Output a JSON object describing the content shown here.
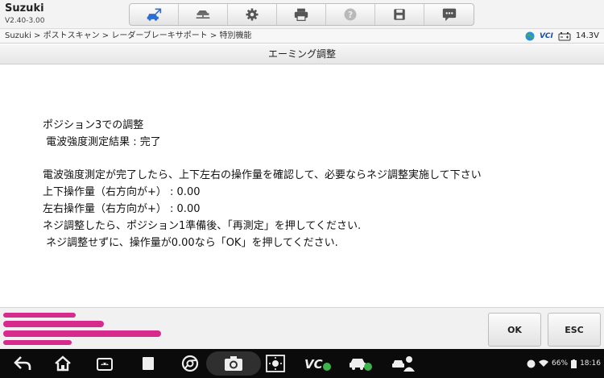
{
  "header": {
    "brand": "Suzuki",
    "version": "V2.40-3.00",
    "toolbar": [
      {
        "icon": "car-arrow-icon"
      },
      {
        "icon": "lift-icon"
      },
      {
        "icon": "gear-icon"
      },
      {
        "icon": "printer-icon"
      },
      {
        "icon": "help-icon"
      },
      {
        "icon": "save-icon"
      },
      {
        "icon": "chat-icon"
      }
    ]
  },
  "breadcrumb": "Suzuki > ポストスキャン > レーダーブレーキサポート > 特別機能",
  "status": {
    "vci_label": "VCI",
    "voltage": "14.3V"
  },
  "page": {
    "title": "エーミング調整"
  },
  "content": {
    "paragraph1": "ポジション3での調整\n 電波強度測定結果 : 完了",
    "paragraph2": "電波強度測定が完了したら、上下左右の操作量を確認して、必要ならネジ調整実施して下さい\n上下操作量（右方向が+） : 0.00\n左右操作量（右方向が+） : 0.00\nネジ調整したら、ポジション1準備後、「再測定」を押してください.\n ネジ調整せずに、操作量が0.00なら「OK」を押してください."
  },
  "buttons": {
    "ok": "OK",
    "esc": "ESC"
  },
  "system": {
    "battery": "66%",
    "time": "18:16"
  },
  "colors": {
    "redaction": "#d62a8c",
    "toolbar_icon": "#555555",
    "active_icon": "#2a6fd6"
  }
}
